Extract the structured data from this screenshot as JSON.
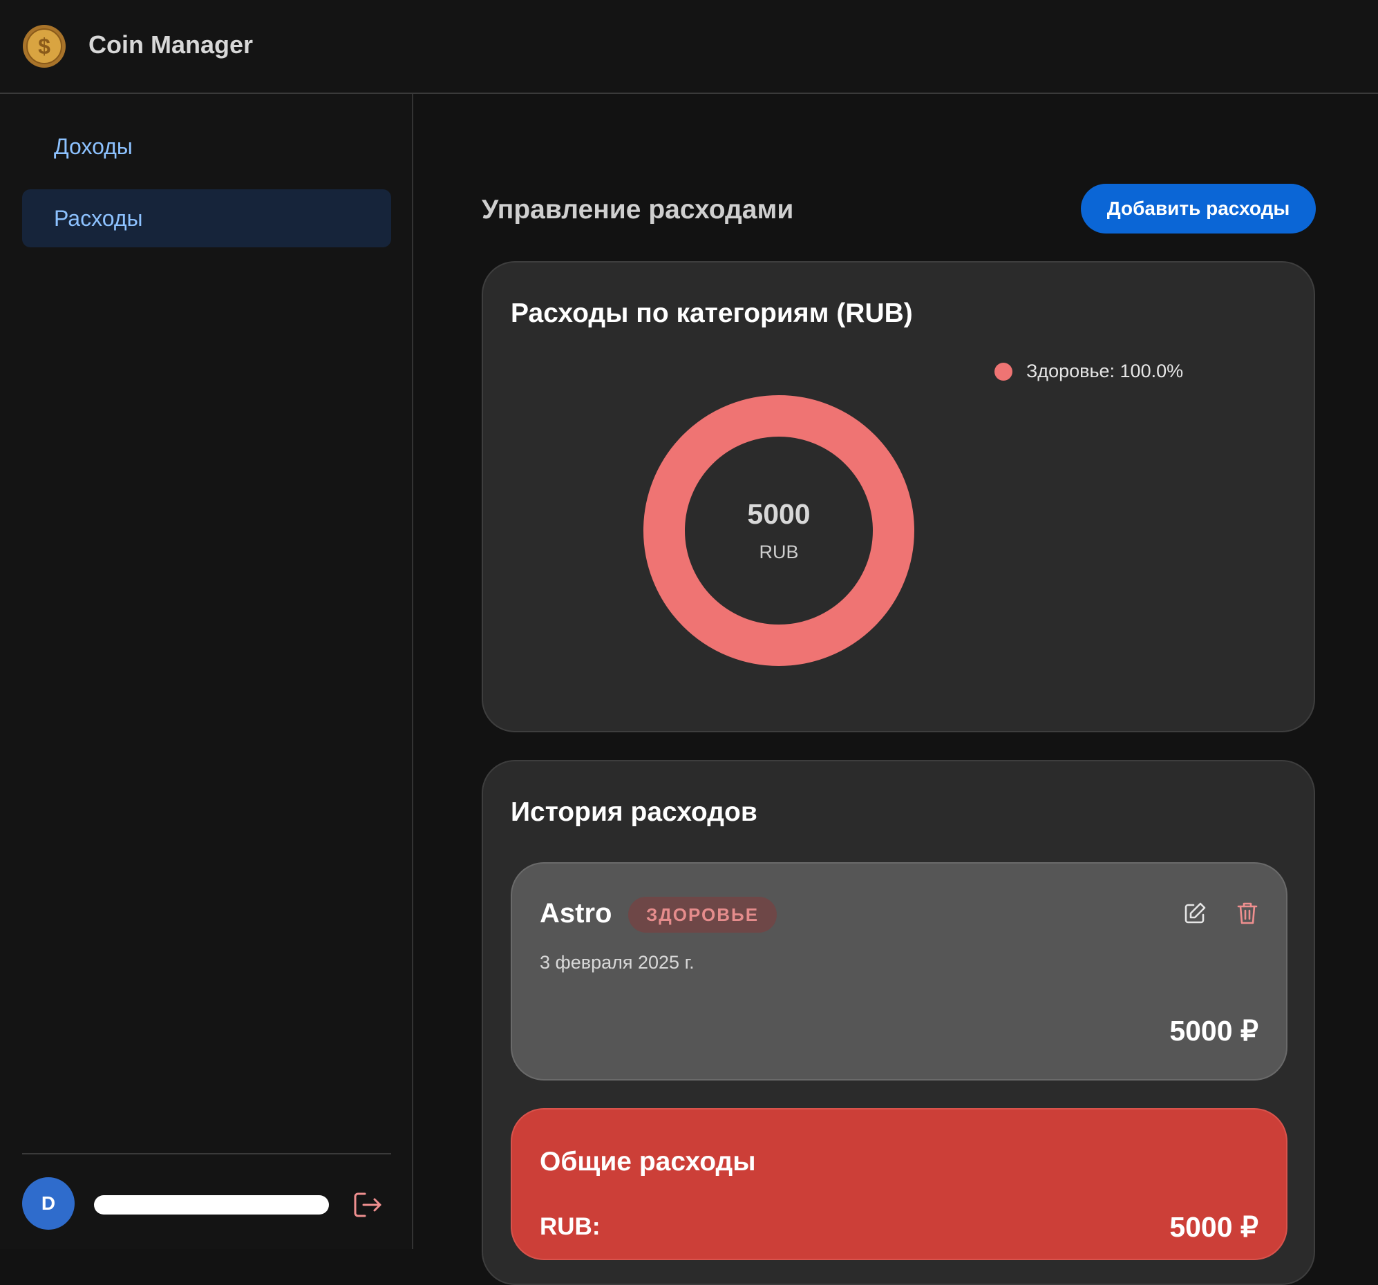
{
  "app": {
    "title": "Coin Manager",
    "logo_icon": "coin-dollar-icon"
  },
  "sidebar": {
    "items": [
      {
        "label": "Доходы",
        "active": false
      },
      {
        "label": "Расходы",
        "active": true
      }
    ],
    "user": {
      "initial": "D"
    },
    "logout_icon": "logout-icon"
  },
  "main": {
    "title": "Управление расходами",
    "add_button": "Добавить расходы"
  },
  "chart_card": {
    "title": "Расходы по категориям (RUB)",
    "center_value": "5000",
    "center_unit": "RUB"
  },
  "chart_data": {
    "type": "pie",
    "subtype": "donut",
    "title": "Расходы по категориям (RUB)",
    "categories": [
      "Здоровье"
    ],
    "values": [
      5000
    ],
    "colors": [
      "#ef7473"
    ],
    "legend": [
      {
        "label": "Здоровье: 100.0%",
        "color": "#ef7473"
      }
    ],
    "legend_position": "top-right",
    "total": "5000",
    "unit": "RUB"
  },
  "history": {
    "title": "История расходов",
    "entries": [
      {
        "name": "Astro",
        "category": "ЗДОРОВЬЕ",
        "date": "3 февраля 2025 г.",
        "amount": "5000 ₽",
        "edit_icon": "edit-icon",
        "delete_icon": "trash-icon"
      }
    ],
    "total": {
      "title": "Общие расходы",
      "label": "RUB:",
      "value": "5000 ₽"
    }
  },
  "colors": {
    "accent": "#0b66d6",
    "health": "#ef7473",
    "total_bg": "#cc3f38",
    "nav_text": "#8dc2ff"
  }
}
